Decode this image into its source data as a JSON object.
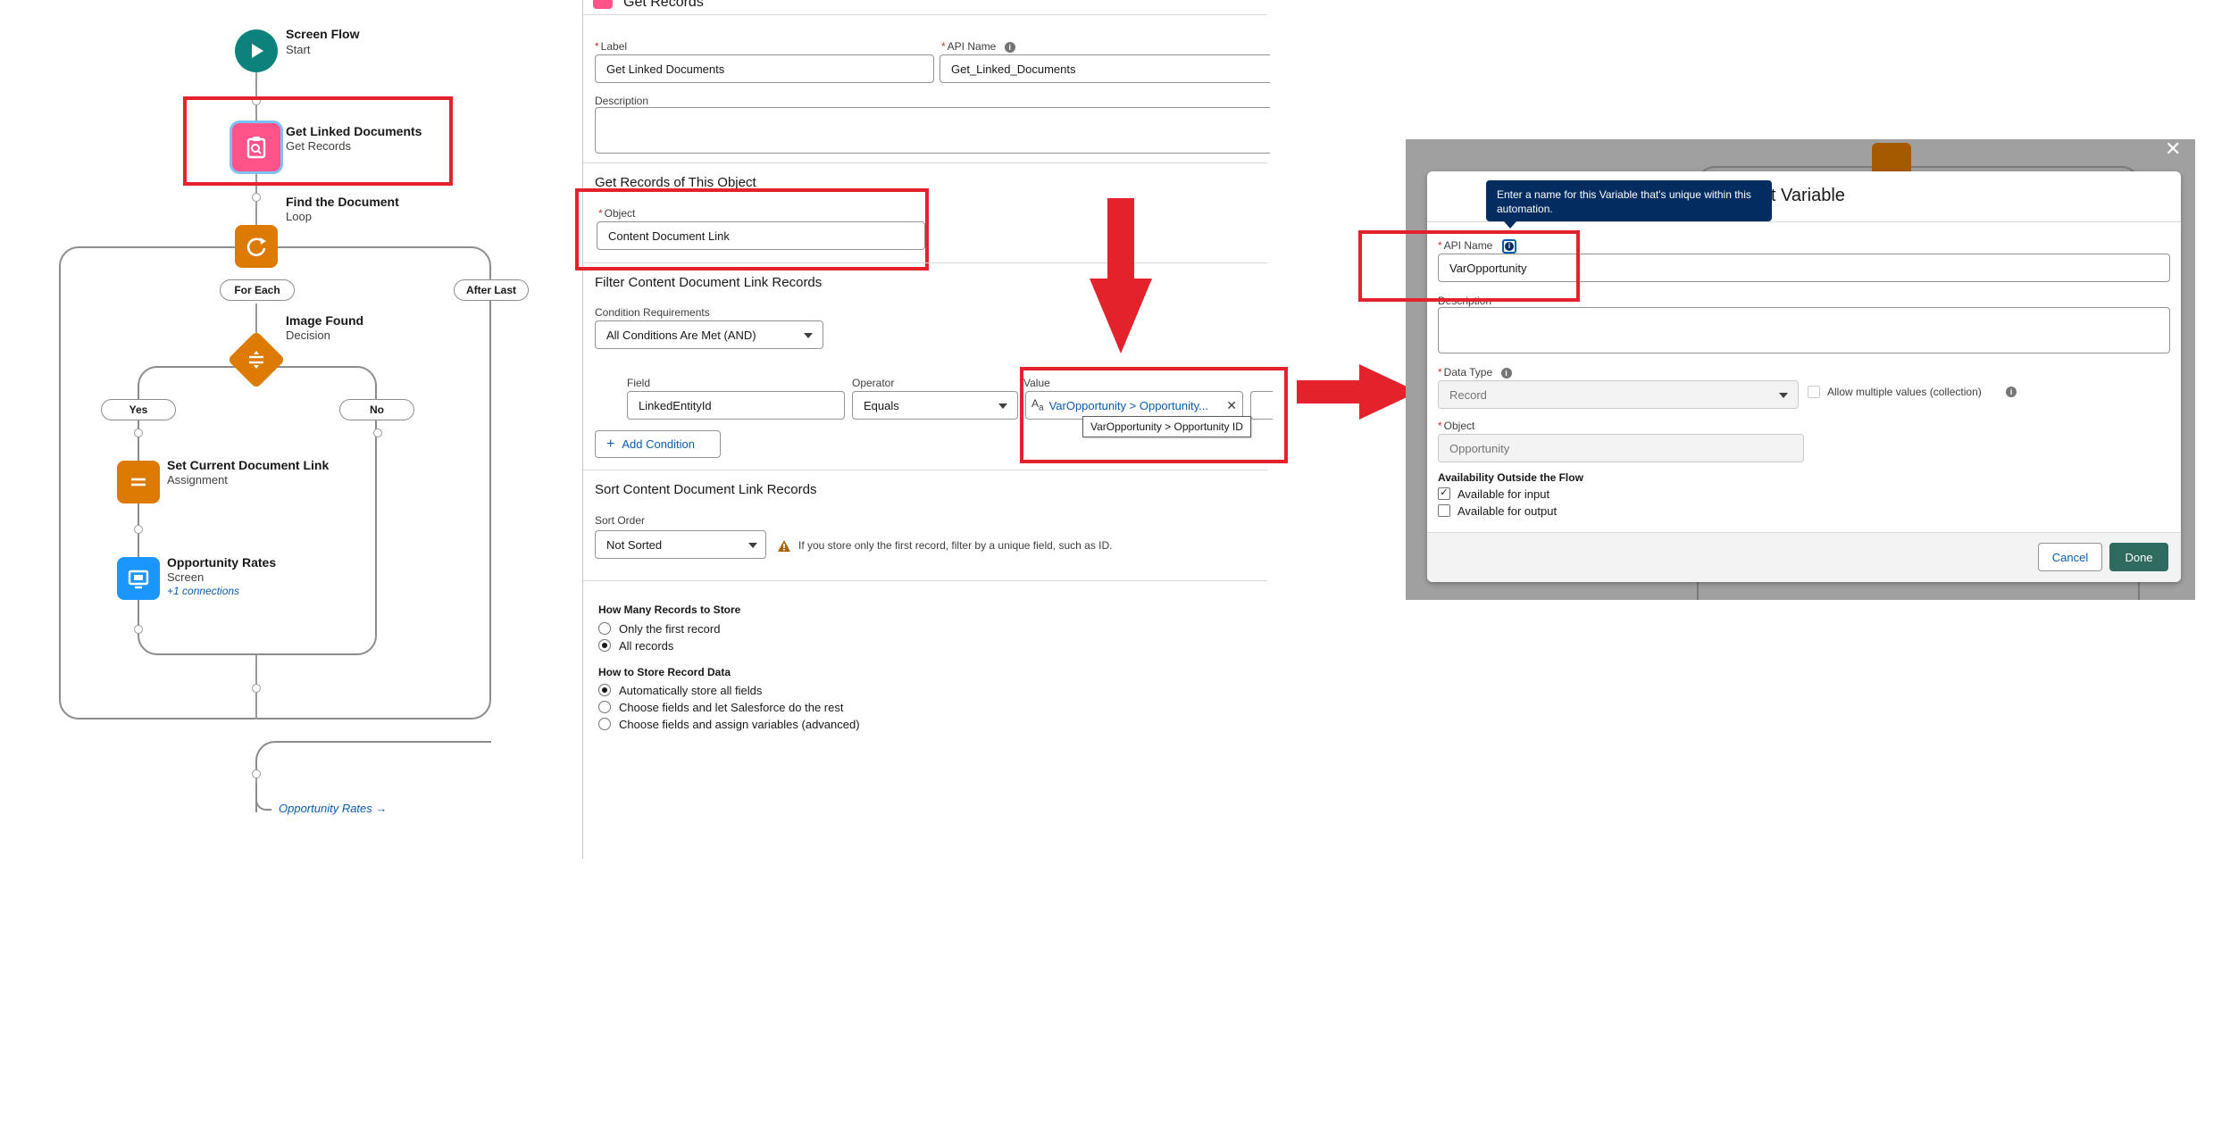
{
  "flow": {
    "start": {
      "title": "Screen Flow",
      "subtitle": "Start"
    },
    "get_records": {
      "title": "Get Linked Documents",
      "subtitle": "Get Records"
    },
    "loop": {
      "title": "Find the Document",
      "subtitle": "Loop"
    },
    "for_each_label": "For Each",
    "after_last_label": "After Last",
    "decision": {
      "title": "Image Found",
      "subtitle": "Decision"
    },
    "yes_label": "Yes",
    "no_label": "No",
    "assignment": {
      "title": "Set Current Document Link",
      "subtitle": "Assignment"
    },
    "screen": {
      "title": "Opportunity Rates",
      "subtitle": "Screen",
      "connections": "+1 connections"
    },
    "bottom_link": "Opportunity Rates →"
  },
  "get_records_panel": {
    "header": "Get Records",
    "label_label": "Label",
    "label_value": "Get Linked Documents",
    "api_name_label": "API Name",
    "api_name_value": "Get_Linked_Documents",
    "description_label": "Description",
    "object_section": "Get Records of This Object",
    "object_label": "Object",
    "object_value": "Content Document Link",
    "filter_section": "Filter Content Document Link Records",
    "condition_label": "Condition Requirements",
    "condition_value": "All Conditions Are Met (AND)",
    "field_label": "Field",
    "field_value": "LinkedEntityId",
    "operator_label": "Operator",
    "operator_value": "Equals",
    "value_label": "Value",
    "value_pill": "VarOpportunity > Opportunity...",
    "value_tooltip": "VarOpportunity > Opportunity ID",
    "add_condition": "Add Condition",
    "sort_section": "Sort Content Document Link Records",
    "sort_order_label": "Sort Order",
    "sort_order_value": "Not Sorted",
    "sort_hint": "If you store only the first record, filter by a unique field, such as ID.",
    "how_many_label": "How Many Records to Store",
    "how_many_options": [
      "Only the first record",
      "All records"
    ],
    "how_store_label": "How to Store Record Data",
    "how_store_options": [
      "Automatically store all fields",
      "Choose fields and let Salesforce do the rest",
      "Choose fields and assign variables (advanced)"
    ]
  },
  "variable_modal": {
    "title": "Edit Variable",
    "tooltip": "Enter a name for this Variable that's unique within this automation.",
    "api_name_label": "API Name",
    "api_name_value": "VarOpportunity",
    "description_label": "Description",
    "data_type_label": "Data Type",
    "data_type_value": "Record",
    "allow_multiple": "Allow multiple values (collection)",
    "object_label": "Object",
    "object_value": "Opportunity",
    "availability_label": "Availability Outside the Flow",
    "input_label": "Available for input",
    "output_label": "Available for output",
    "cancel": "Cancel",
    "done": "Done"
  },
  "colors": {
    "annotation_red": "#e3222b",
    "start_teal": "#0b827c",
    "get_records_pink": "#ff538a",
    "loop_orange": "#dd7a01",
    "screen_blue": "#1b96ff",
    "done_green": "#2e6b5e",
    "tooltip_navy": "#032d60"
  }
}
